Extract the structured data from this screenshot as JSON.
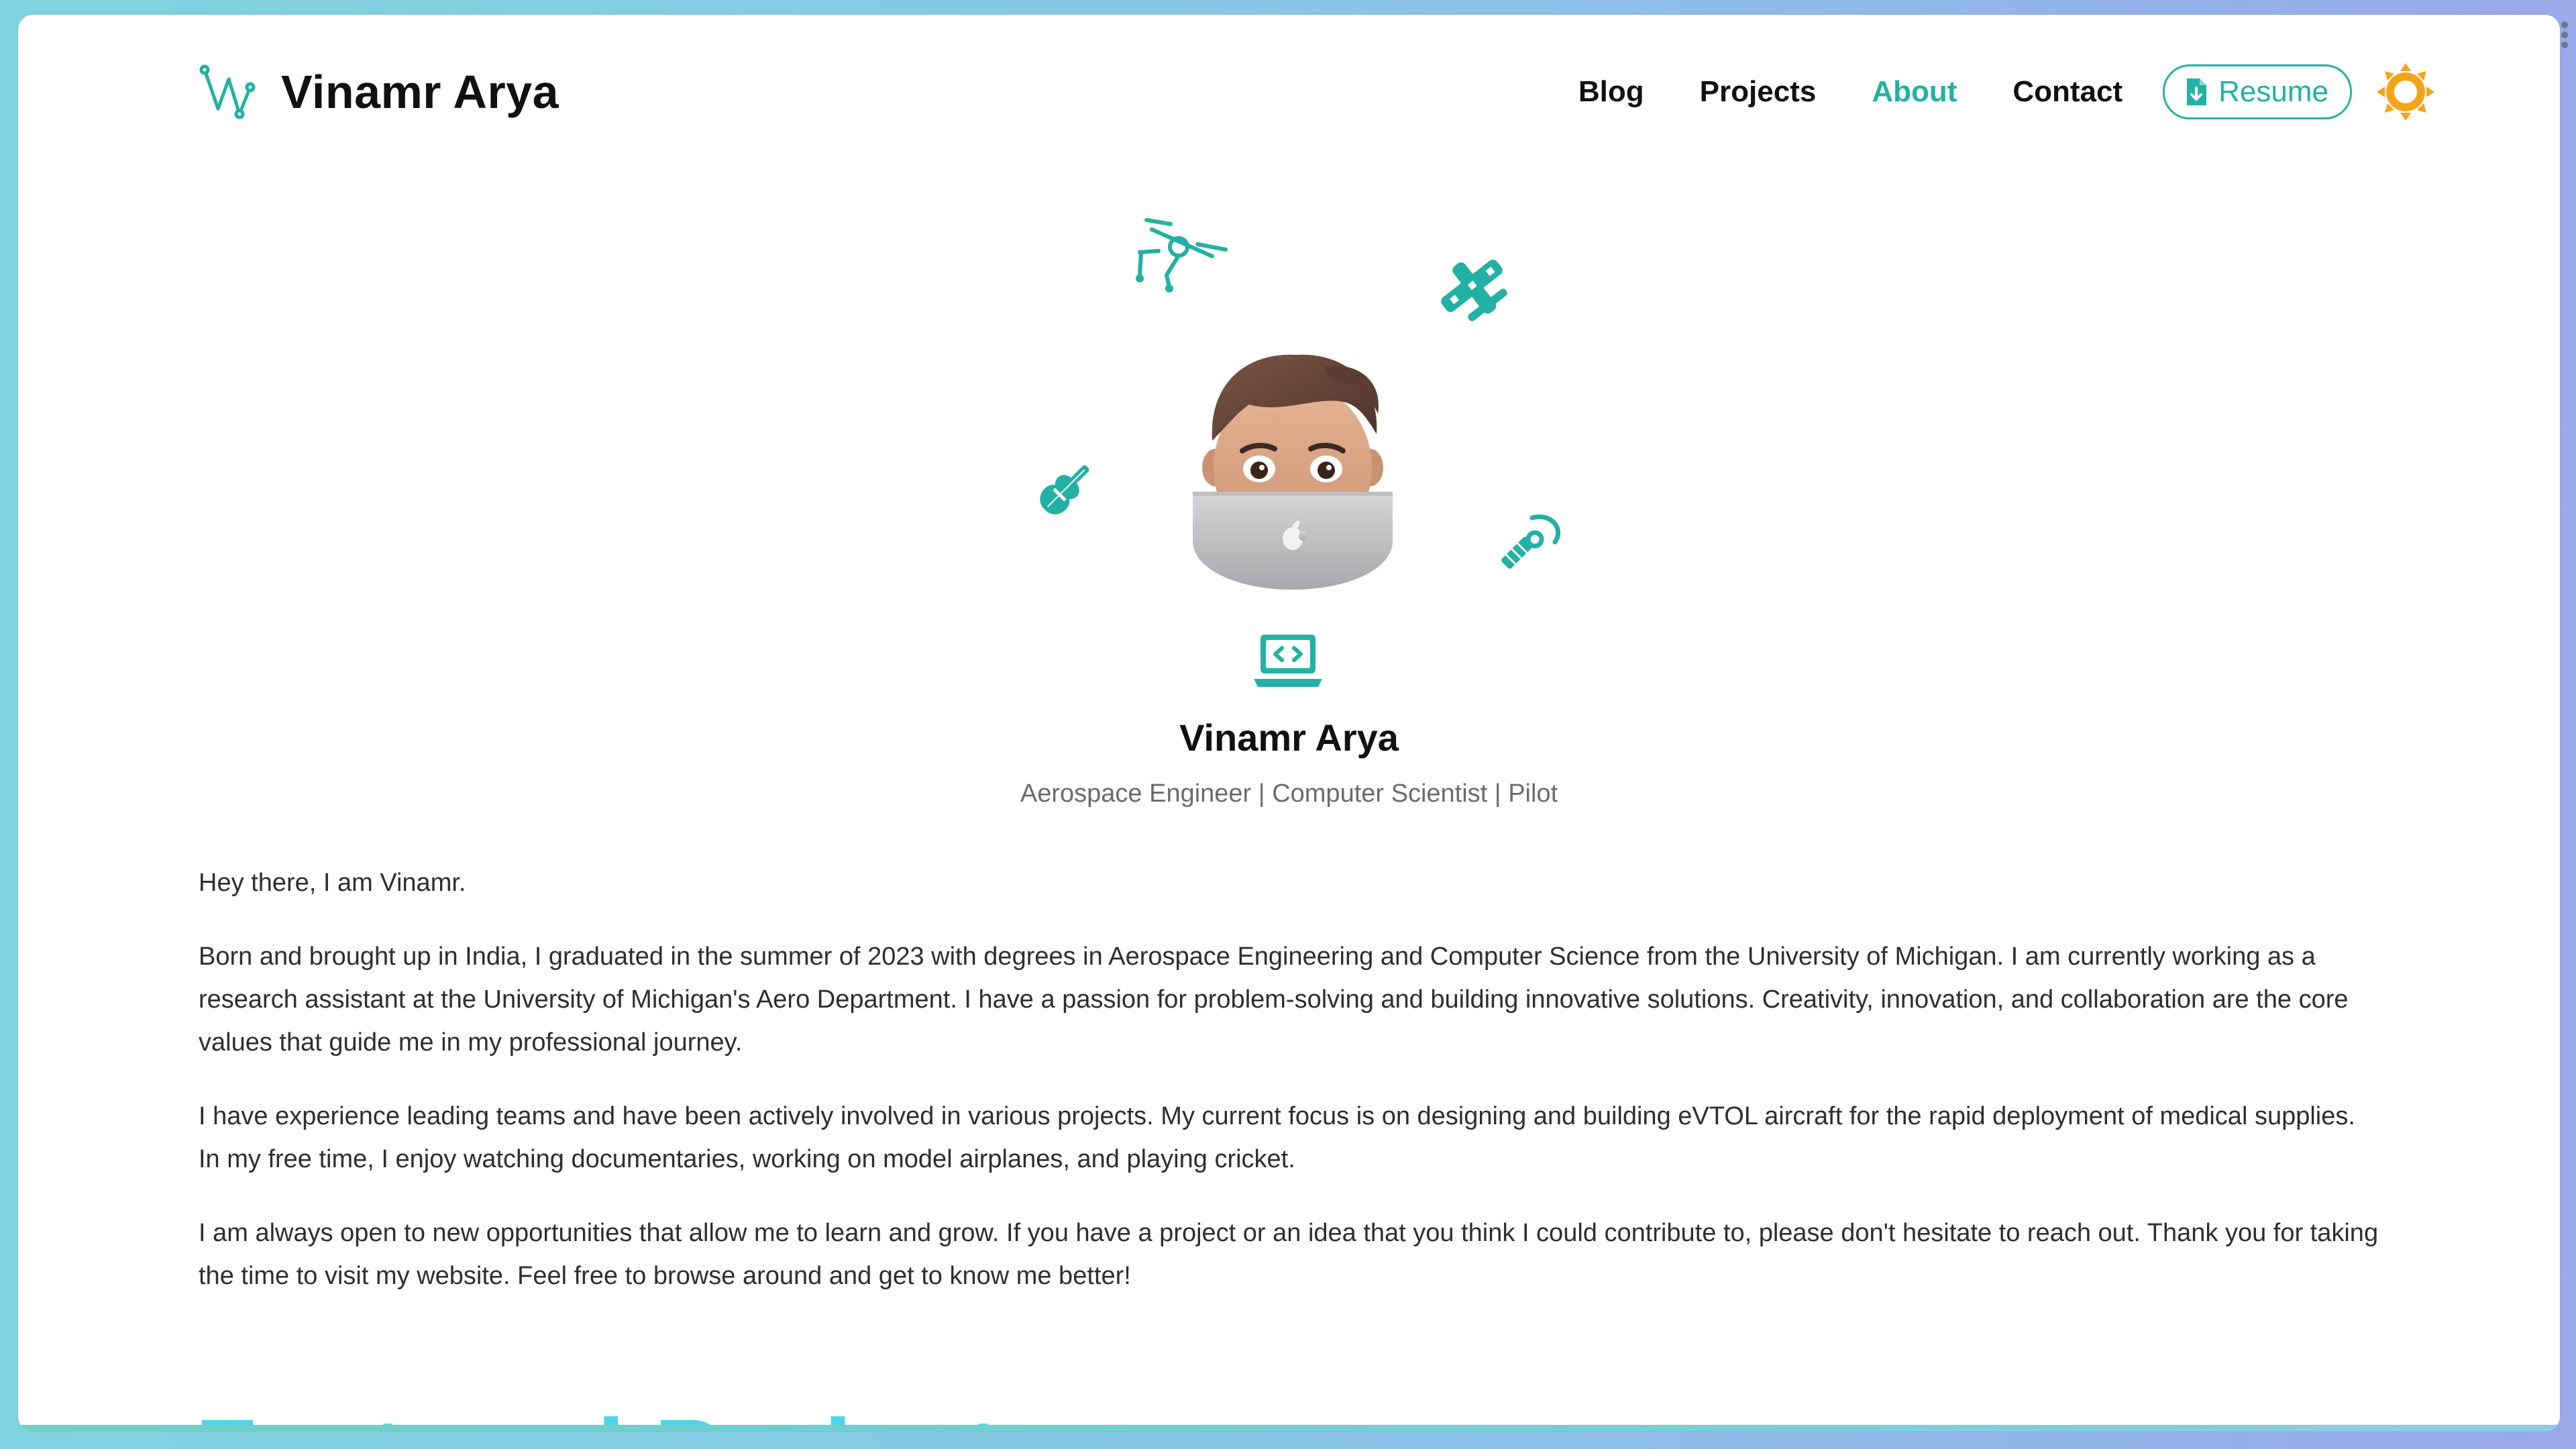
{
  "site": {
    "brand_name": "Vinamr Arya"
  },
  "nav": {
    "items": [
      {
        "label": "Blog",
        "active": false
      },
      {
        "label": "Projects",
        "active": false
      },
      {
        "label": "About",
        "active": true
      },
      {
        "label": "Contact",
        "active": false
      }
    ],
    "resume_label": "Resume",
    "theme_icon": "sun-icon"
  },
  "hero": {
    "name": "Vinamr Arya",
    "tagline": "Aerospace Engineer | Computer Scientist | Pilot",
    "icons": [
      "drone-icon",
      "airplane-icon",
      "violin-icon",
      "satellite-icon",
      "memoji-avatar",
      "laptop-code-icon"
    ]
  },
  "about": {
    "paragraphs": [
      "Hey there, I am Vinamr.",
      "Born and brought up in India, I graduated in the summer of 2023 with degrees in Aerospace Engineering and Computer Science from the University of Michigan. I am currently working as a research assistant at the University of Michigan's Aero Department. I have a passion for problem-solving and building innovative solutions. Creativity, innovation, and collaboration are the core values that guide me in my professional journey.",
      "I have experience leading teams and have been actively involved in various projects. My current focus is on designing and building eVTOL aircraft for the rapid deployment of medical supplies. In my free time, I enjoy watching documentaries, working on model airplanes, and playing cricket.",
      "I am always open to new opportunities that allow me to learn and grow. If you have a project or an idea that you think I could contribute to, please don't hesitate to reach out. Thank you for taking the time to visit my website. Feel free to browse around and get to know me better!"
    ]
  },
  "featured": {
    "heading": "Featured Projects"
  },
  "colors": {
    "accent": "#22b1a4",
    "sun": "#f5a418",
    "heading_cyan": "#50d4ea",
    "text": "#2e2e2e",
    "muted": "#6b6b6b"
  }
}
